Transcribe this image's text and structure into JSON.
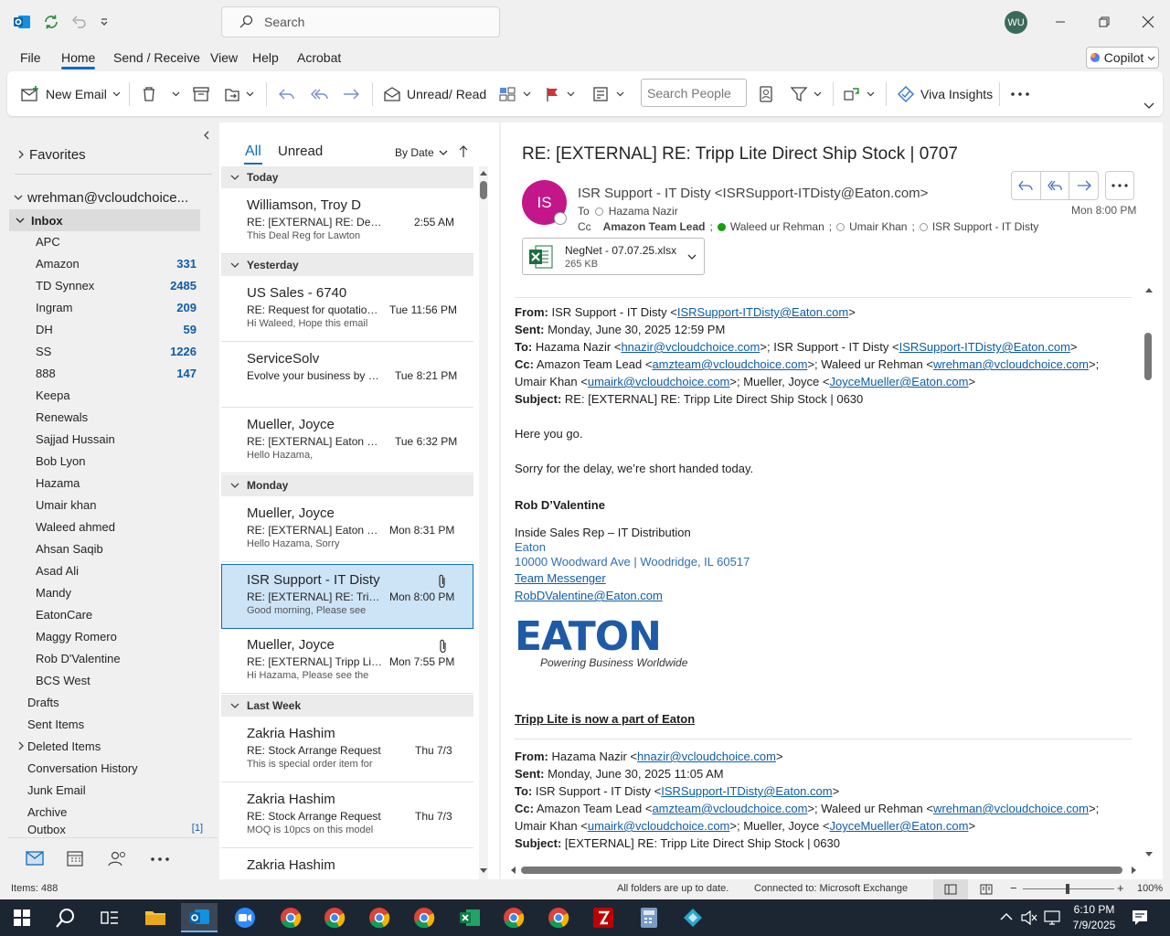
{
  "titlebar": {
    "search_placeholder": "Search",
    "avatar_initials": "WU"
  },
  "menu": {
    "items": [
      "File",
      "Home",
      "Send / Receive",
      "View",
      "Help",
      "Acrobat"
    ],
    "copilot": "Copilot"
  },
  "ribbon": {
    "new_email": "New Email",
    "unread_read": "Unread/ Read",
    "search_people": "Search People",
    "viva": "Viva Insights"
  },
  "folders": {
    "favorites": "Favorites",
    "account": "wrehman@vcloudchoice...",
    "inbox": "Inbox",
    "subfolders": [
      {
        "name": "APC",
        "count": ""
      },
      {
        "name": "Amazon",
        "count": "331"
      },
      {
        "name": "TD Synnex",
        "count": "2485"
      },
      {
        "name": "Ingram",
        "count": "209"
      },
      {
        "name": "DH",
        "count": "59"
      },
      {
        "name": "SS",
        "count": "1226"
      },
      {
        "name": "888",
        "count": "147"
      },
      {
        "name": "Keepa",
        "count": ""
      },
      {
        "name": "Renewals",
        "count": ""
      },
      {
        "name": "Sajjad Hussain",
        "count": ""
      },
      {
        "name": "Bob Lyon",
        "count": ""
      },
      {
        "name": "Hazama",
        "count": ""
      },
      {
        "name": "Umair khan",
        "count": ""
      },
      {
        "name": "Waleed ahmed",
        "count": ""
      },
      {
        "name": "Ahsan Saqib",
        "count": ""
      },
      {
        "name": "Asad Ali",
        "count": ""
      },
      {
        "name": "Mandy",
        "count": ""
      },
      {
        "name": "EatonCare",
        "count": ""
      },
      {
        "name": "Maggy Romero",
        "count": ""
      },
      {
        "name": "Rob D'Valentine",
        "count": ""
      },
      {
        "name": "BCS West",
        "count": ""
      }
    ],
    "top": [
      "Drafts",
      "Sent Items",
      "Deleted Items",
      "Conversation History",
      "Junk Email",
      "Archive",
      "Outbox"
    ],
    "outbox_count": "[1]"
  },
  "maillist": {
    "tab_all": "All",
    "tab_unread": "Unread",
    "sort": "By Date",
    "groups": {
      "today": "Today",
      "yesterday": "Yesterday",
      "monday": "Monday",
      "lastweek": "Last Week"
    },
    "items": [
      {
        "sender": "Williamson, Troy D",
        "subject": "RE: [EXTERNAL] RE: Deal Re...",
        "time": "2:55 AM",
        "preview": "This Deal Reg for Lawton"
      },
      {
        "sender": "US Sales - 6740",
        "subject": "RE: Request for quotation |...",
        "time": "Tue 11:56 PM",
        "preview": "Hi Waleed,  Hope this email"
      },
      {
        "sender": "ServiceSolv",
        "subject": "Evolve your business by off...",
        "time": "Tue 8:21 PM",
        "preview": ""
      },
      {
        "sender": "Mueller, Joyce",
        "subject": "RE: [EXTERNAL] Eaton Freig...",
        "time": "Tue 6:32 PM",
        "preview": "Hello Hazama,"
      },
      {
        "sender": "Mueller, Joyce",
        "subject": "RE: [EXTERNAL] Eaton Freig...",
        "time": "Mon 8:31 PM",
        "preview": "Hello Hazama,  Sorry"
      },
      {
        "sender": "ISR Support - IT Disty",
        "subject": "RE: [EXTERNAL] RE: Tripp Lit...",
        "time": "Mon 8:00 PM",
        "preview": "Good morning,  Please see"
      },
      {
        "sender": "Mueller, Joyce",
        "subject": "RE: [EXTERNAL] Tripp Lite D...",
        "time": "Mon 7:55 PM",
        "preview": "Hi Hazama,  Please see the"
      },
      {
        "sender": "Zakria Hashim",
        "subject": "RE: Stock Arrange Request",
        "time": "Thu 7/3",
        "preview": "This is special order item for"
      },
      {
        "sender": "Zakria Hashim",
        "subject": "RE: Stock Arrange Request",
        "time": "Thu 7/3",
        "preview": "MOQ is 10pcs on this model"
      },
      {
        "sender": "Zakria Hashim",
        "subject": "",
        "time": "",
        "preview": ""
      }
    ]
  },
  "reading": {
    "subject": "RE: [EXTERNAL] RE: Tripp Lite Direct Ship Stock | 0707",
    "sender_initials": "IS",
    "from": "ISR Support - IT Disty <ISRSupport-ITDisty@Eaton.com>",
    "to_label": "To",
    "to": "Hazama Nazir",
    "cc_label": "Cc",
    "cc1": "Amazon Team Lead",
    "cc2": "Waleed ur Rehman",
    "cc3": "Umair Khan",
    "cc4": "ISR Support - IT Disty",
    "date": "Mon 8:00 PM",
    "attachment_name": "NegNet - 07.07.25.xlsx",
    "attachment_size": "265 KB",
    "q1": {
      "from_label": "From:",
      "from": "ISR Support - IT Disty <",
      "from_link": "ISRSupport-ITDisty@Eaton.com",
      "from_end": ">",
      "sent_label": "Sent:",
      "sent": "Monday, June 30, 2025 12:59 PM",
      "to_label": "To:",
      "to_a": "Hazama Nazir <",
      "to_link1": "hnazir@vcloudchoice.com",
      "to_b": ">; ISR Support - IT Disty <",
      "to_link2": "ISRSupport-ITDisty@Eaton.com",
      "to_end": ">",
      "cc_label": "Cc:",
      "cc_a": "Amazon Team Lead <",
      "cc_link1": "amzteam@vcloudchoice.com",
      "cc_b": ">; Waleed ur Rehman <",
      "cc_link2": "wrehman@vcloudchoice.com",
      "cc_end": ">;",
      "cc2_a": "Umair Khan <",
      "cc2_link1": "umairk@vcloudchoice.com",
      "cc2_b": ">; Mueller, Joyce <",
      "cc2_link2": "JoyceMueller@Eaton.com",
      "cc2_end": ">",
      "subj_label": "Subject:",
      "subj": "RE: [EXTERNAL] RE: Tripp Lite Direct Ship Stock | 0630"
    },
    "body1": "Here you go.",
    "body2": "Sorry for the delay, we’re short handed today.",
    "sig_name": "Rob D’Valentine",
    "sig_title": "Inside Sales Rep – IT Distribution",
    "sig_company": "Eaton",
    "sig_address": "10000 Woodward Ave | Woodridge, IL 60517",
    "sig_messenger": "Team Messenger",
    "sig_email": "RobDValentine@Eaton.com",
    "logo_text": "EATON",
    "logo_tagline": "Powering Business Worldwide",
    "tripp": "Tripp Lite is now a part of Eaton",
    "q2": {
      "from_label": "From:",
      "from": "Hazama Nazir <",
      "from_link": "hnazir@vcloudchoice.com",
      "from_end": ">",
      "sent_label": "Sent:",
      "sent": "Monday, June 30, 2025 11:05 AM",
      "to_label": "To:",
      "to_a": "ISR Support - IT Disty <",
      "to_link1": "ISRSupport-ITDisty@Eaton.com",
      "to_end": ">",
      "cc_label": "Cc:",
      "cc_a": "Amazon Team Lead <",
      "cc_link1": "amzteam@vcloudchoice.com",
      "cc_b": ">; Waleed ur Rehman <",
      "cc_link2": "wrehman@vcloudchoice.com",
      "cc_end": ">;",
      "cc2_a": "Umair Khan <",
      "cc2_link1": "umairk@vcloudchoice.com",
      "cc2_b": ">; Mueller, Joyce <",
      "cc2_link2": "JoyceMueller@Eaton.com",
      "cc2_end": ">",
      "subj_label": "Subject:",
      "subj": "[EXTERNAL] RE: Tripp Lite Direct Ship Stock | 0630"
    }
  },
  "status": {
    "items": "Items: 488",
    "sync": "All folders are up to date.",
    "connected": "Connected to: Microsoft Exchange",
    "zoom": "100%"
  },
  "taskbar": {
    "time": "6:10 PM",
    "date": "7/9/2025"
  },
  "colors": {
    "accent": "#0f6cbd",
    "avatar_is": "#c2168a",
    "selected": "#cde4f7",
    "taskbar": "#1c2633"
  }
}
